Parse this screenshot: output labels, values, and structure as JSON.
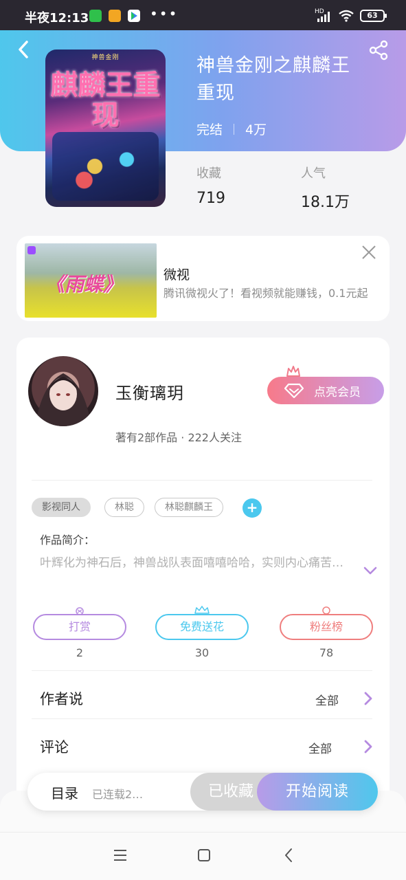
{
  "status_bar": {
    "time": "半夜12:13",
    "dots": "•••",
    "network": "HD",
    "battery": "63"
  },
  "book": {
    "title": "神兽金刚之麒麟王重现",
    "status": "完结",
    "word_count": "4万",
    "cover_title": "麒麟王重现",
    "cover_series": "神兽金刚",
    "stats": [
      {
        "label": "收藏",
        "value": "719"
      },
      {
        "label": "人气",
        "value": "18.1万"
      }
    ]
  },
  "ad": {
    "name": "微视",
    "description": "腾讯微视火了！看视频就能赚钱，0.1元起",
    "image_title": "《雨蝶》"
  },
  "author": {
    "name": "玉衡璃玥",
    "summary": "著有2部作品 · 222人关注",
    "vip_label": "点亮会员"
  },
  "tags": [
    "影视同人",
    "林聪",
    "林聪麒麟王"
  ],
  "tag_add": "+",
  "intro": {
    "label": "作品简介：",
    "text": "叶辉化为神石后，神兽战队表面嘻嘻哈哈，实则内心痛苦…"
  },
  "rewards": [
    {
      "label": "打赏",
      "count": "2",
      "color": "#b58ae0"
    },
    {
      "label": "免费送花",
      "count": "30",
      "color": "#4bc8ee"
    },
    {
      "label": "粉丝榜",
      "count": "78",
      "color": "#ef7e7e"
    }
  ],
  "sections": [
    {
      "label": "作者说",
      "action": "全部"
    },
    {
      "label": "评论",
      "action": "全部"
    }
  ],
  "bottom_bar": {
    "toc_label": "目录",
    "toc_sub": "已连载2…",
    "collected_label": "已收藏",
    "read_label": "开始阅读"
  },
  "colors": {
    "header_start": "#4fc7ec",
    "header_end": "#b89be8",
    "accent_purple": "#b58ae0"
  }
}
